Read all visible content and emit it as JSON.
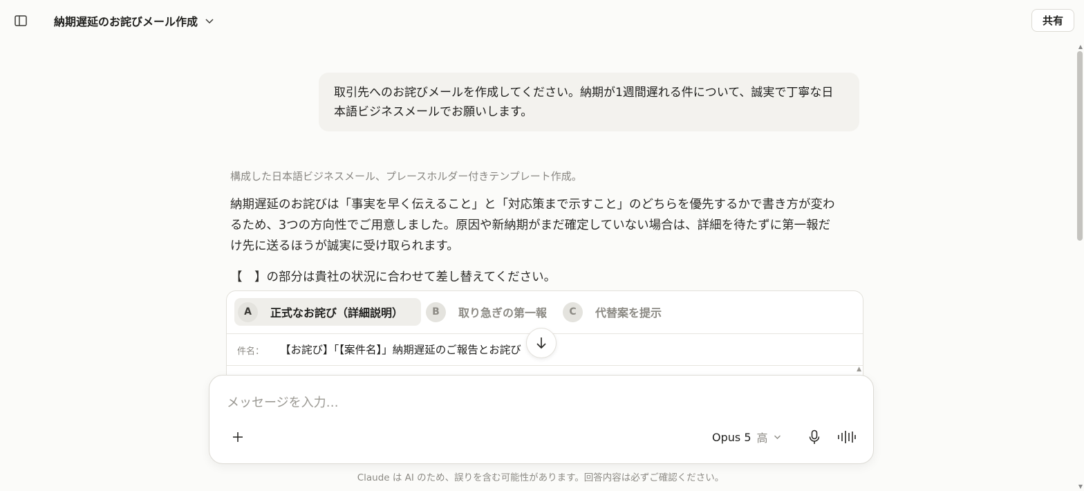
{
  "header": {
    "title": "納期遅延のお詫びメール作成",
    "share_label": "共有"
  },
  "conversation": {
    "user_message": "取引先へのお詫びメールを作成してください。納期が1週間遅れる件について、誠実で丁寧な日本語ビジネスメールでお願いします。",
    "thinking_summary": "構成した日本語ビジネスメール、プレースホルダー付きテンプレート作成。",
    "assistant_paragraph": "納期遅延のお詫びは「事実を早く伝えること」と「対応策まで示すこと」のどちらを優先するかで書き方が変わるため、3つの方向性でご用意しました。原因や新納期がまだ確定していない場合は、詳細を待たずに第一報だけ先に送るほうが誠実に受け取られます。",
    "placeholder_note": "【　】の部分は貴社の状況に合わせて差し替えてください。"
  },
  "email_card": {
    "tabs": [
      {
        "badge": "A",
        "label": "正式なお詫び（詳細説明）",
        "active": true
      },
      {
        "badge": "B",
        "label": "取り急ぎの第一報",
        "active": false
      },
      {
        "badge": "C",
        "label": "代替案を提示",
        "active": false
      }
    ],
    "subject_label": "件名：",
    "subject_value": "【お詫び】「【案件名】」納期遅延のご報告とお詫び"
  },
  "composer": {
    "placeholder": "メッセージを入力…",
    "model_name": "Opus 5",
    "model_level": "高"
  },
  "footer": {
    "disclaimer": "Claude は AI のため、誤りを含む可能性があります。回答内容は必ずご確認ください。"
  },
  "icons": {
    "sidebar_toggle": "sidebar-icon",
    "title_chevron": "chevron-down-icon",
    "scroll_down": "arrow-down-icon",
    "add": "plus-icon",
    "model_chevron": "chevron-down-icon",
    "mic": "microphone-icon",
    "voice": "voice-mode-icon"
  }
}
